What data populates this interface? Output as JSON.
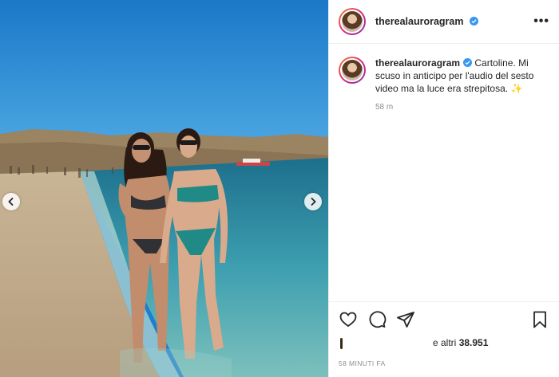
{
  "post": {
    "username": "therealauroragram",
    "verified": true,
    "more_label": "•••",
    "caption": "Cartoline. Mi scuso in anticipo per l'audio del sesto video ma la luce era strepitosa.",
    "caption_emoji": "✨",
    "caption_time": "58 m",
    "likes_prefix": "e altri",
    "likes_count": "38.951",
    "timestamp": "58 MINUTI FA"
  },
  "icons": {
    "like": "heart-icon",
    "comment": "comment-icon",
    "share": "paper-plane-icon",
    "save": "bookmark-icon",
    "verified": "verified-badge-icon",
    "prev": "chevron-left-icon",
    "next": "chevron-right-icon"
  },
  "colors": {
    "verified_blue": "#3897f0",
    "sky": "#1f7fcc",
    "sea": "#2a8fa6",
    "muted_text": "#8e8e8e"
  }
}
